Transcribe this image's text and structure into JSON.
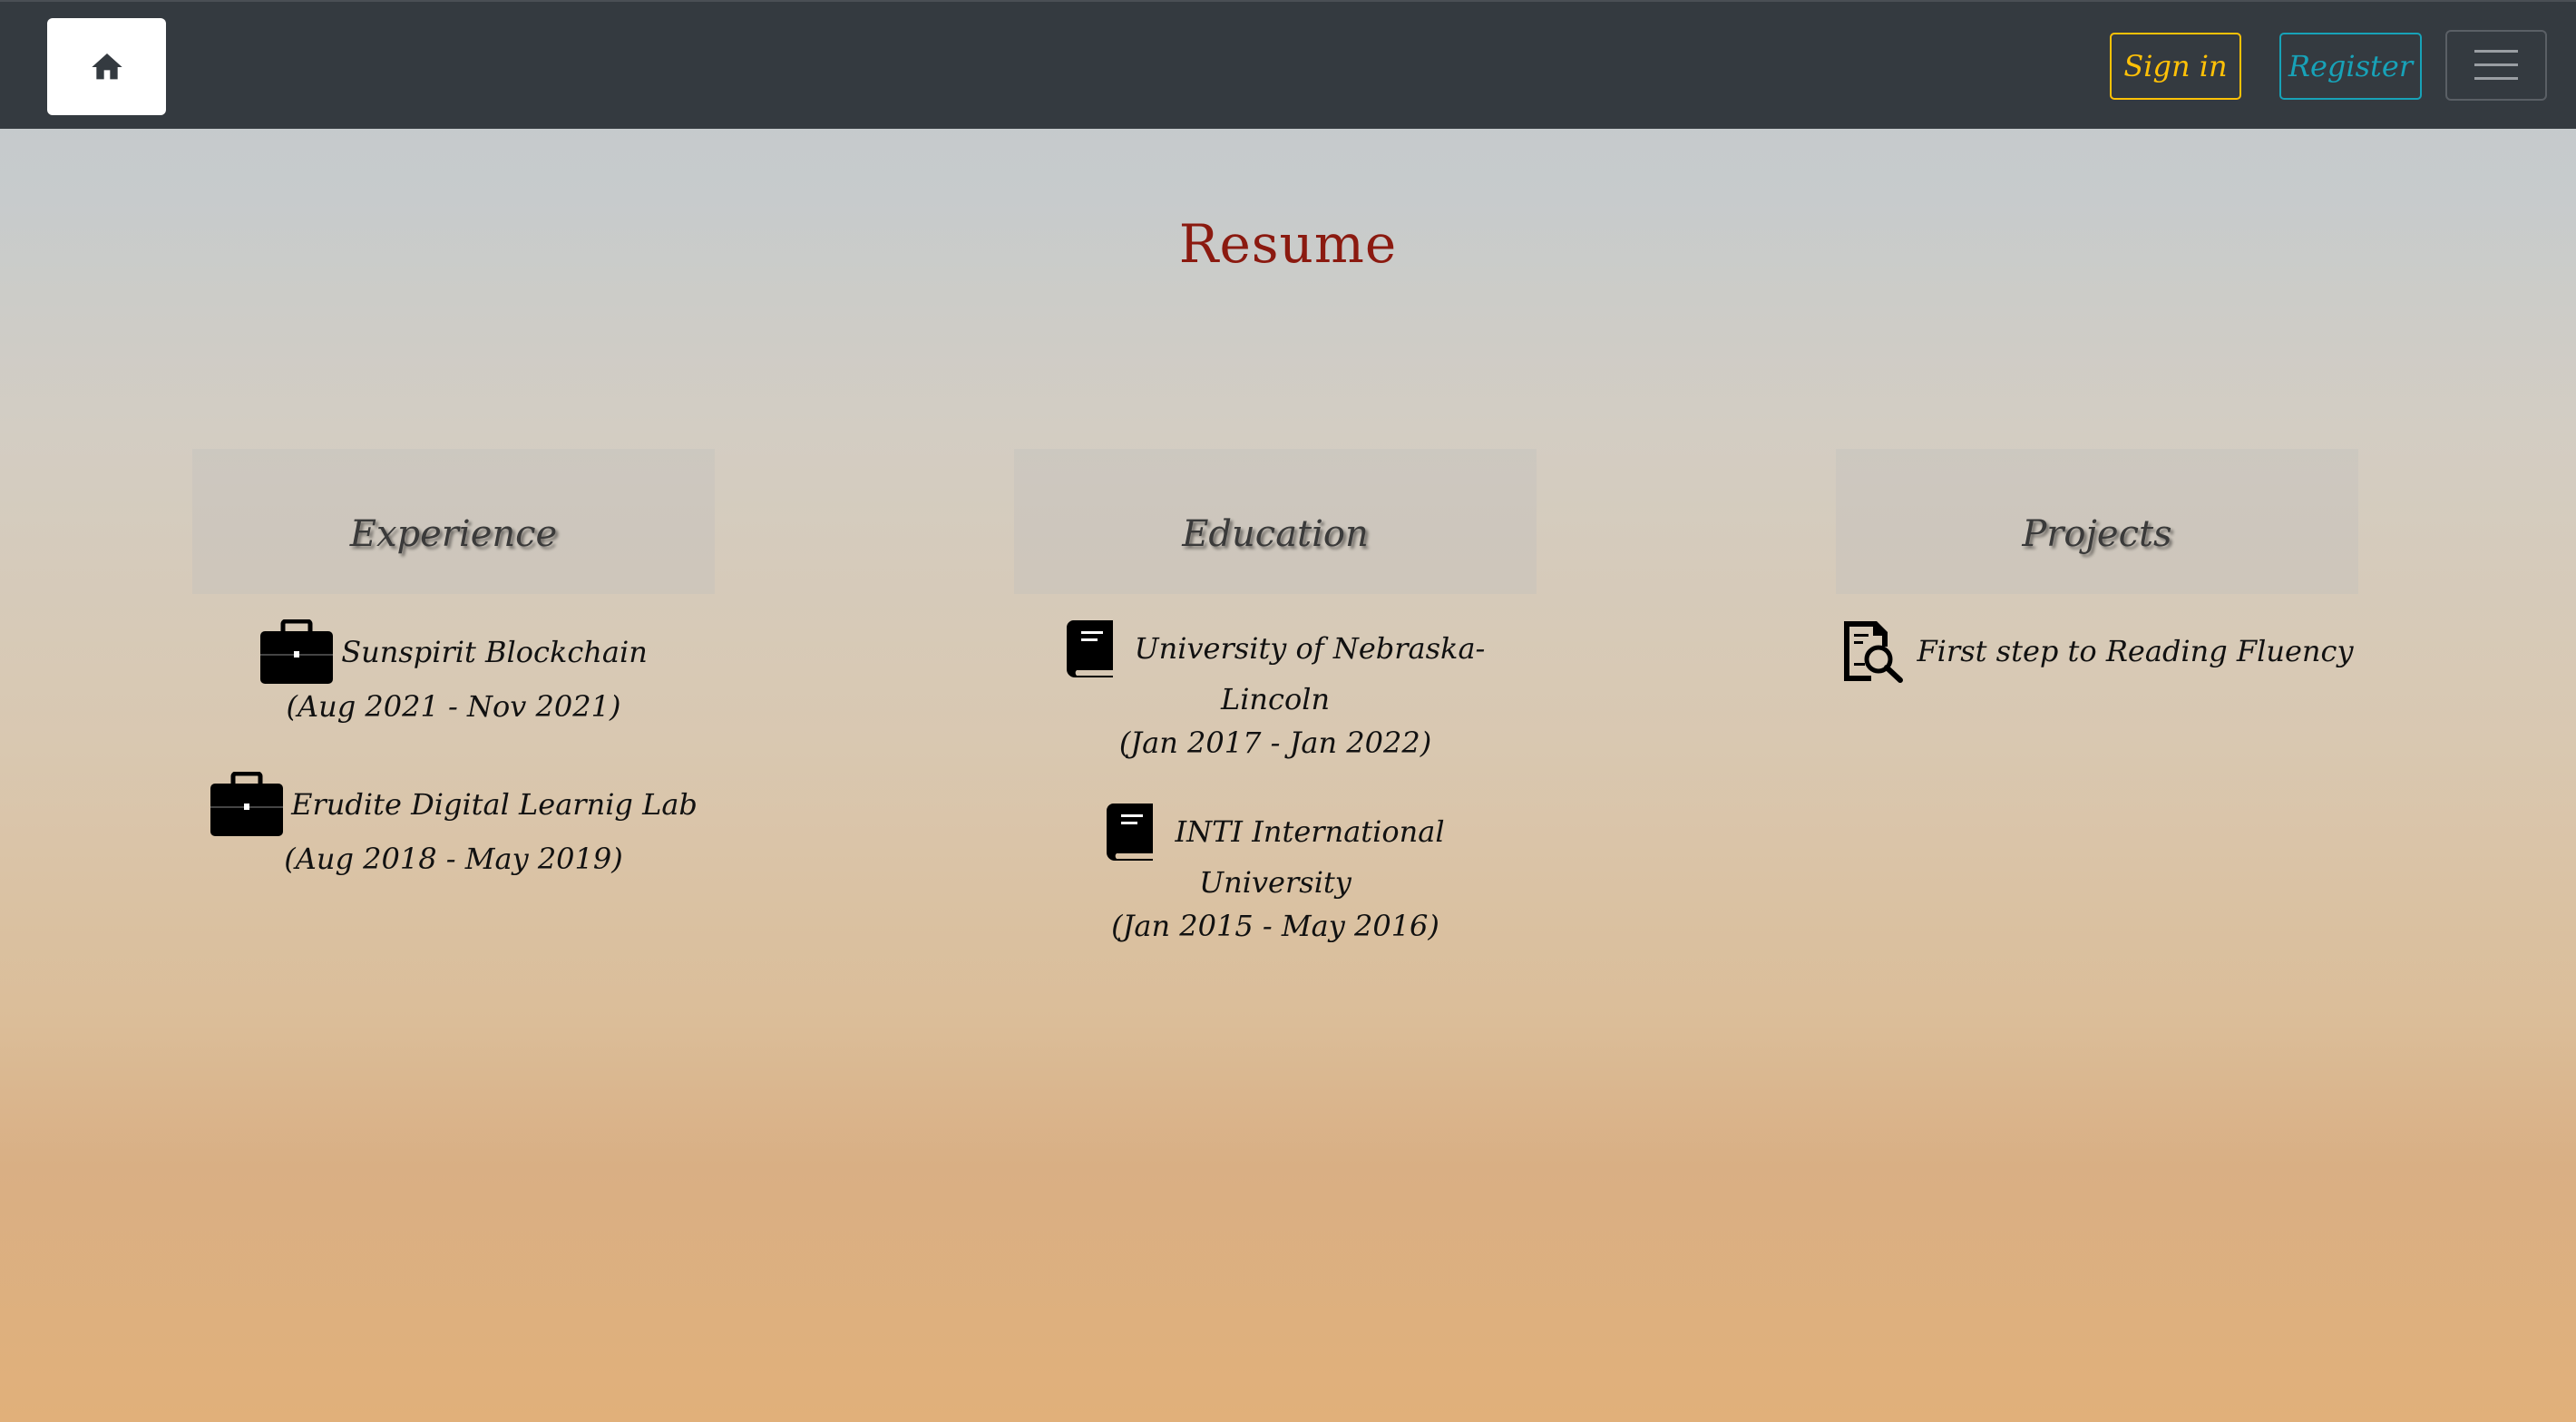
{
  "nav": {
    "home_icon": "home-icon",
    "signin_label": "Sign in",
    "register_label": "Register",
    "menu_icon": "hamburger-menu-icon",
    "colors": {
      "bar": "#343a40",
      "signin": "#ffc107",
      "register": "#17a2b8"
    }
  },
  "page": {
    "title": "Resume",
    "title_color": "#8b1a10"
  },
  "experience": {
    "heading": "Experience",
    "items": [
      {
        "icon": "briefcase-icon",
        "name": "Sunspirit Blockchain",
        "dates": "(Aug 2021 - Nov 2021)"
      },
      {
        "icon": "briefcase-icon",
        "name": "Erudite Digital Learnig Lab",
        "dates": "(Aug 2018 - May 2019)"
      }
    ]
  },
  "education": {
    "heading": "Education",
    "items": [
      {
        "icon": "book-icon",
        "name_line1": "University of Nebraska-",
        "name_line2": "Lincoln",
        "dates": "(Jan 2017 - Jan 2022)"
      },
      {
        "icon": "book-icon",
        "name_line1": "INTI International",
        "name_line2": "University",
        "dates": "(Jan 2015 - May 2016)"
      }
    ]
  },
  "projects": {
    "heading": "Projects",
    "items": [
      {
        "icon": "document-search-icon",
        "name": "First step to Reading Fluency"
      }
    ]
  }
}
